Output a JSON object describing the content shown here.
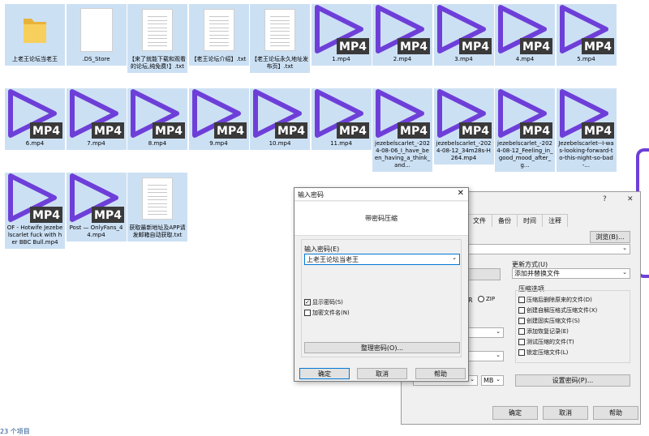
{
  "files": [
    {
      "name": "上老王论坛当老王",
      "kind": "folder"
    },
    {
      "name": ".DS_Store",
      "kind": "blank"
    },
    {
      "name": "【来了就能下载和观看的论坛,纯免费!】.txt",
      "kind": "doc"
    },
    {
      "name": "【老王论坛介绍】.txt",
      "kind": "doc"
    },
    {
      "name": "【老王论坛永久地址发布页】.txt",
      "kind": "doc"
    },
    {
      "name": "1.mp4",
      "kind": "mp4"
    },
    {
      "name": "2.mp4",
      "kind": "mp4"
    },
    {
      "name": "3.mp4",
      "kind": "mp4"
    },
    {
      "name": "4.mp4",
      "kind": "mp4"
    },
    {
      "name": "5.mp4",
      "kind": "mp4"
    },
    {
      "name": "6.mp4",
      "kind": "mp4"
    },
    {
      "name": "7.mp4",
      "kind": "mp4"
    },
    {
      "name": "8.mp4",
      "kind": "mp4"
    },
    {
      "name": "9.mp4",
      "kind": "mp4"
    },
    {
      "name": "10.mp4",
      "kind": "mp4"
    },
    {
      "name": "11.mp4",
      "kind": "mp4"
    },
    {
      "name": "jezebelscarlet_-2024-08-06_I_have_been_having_a_think_and...",
      "kind": "mp4"
    },
    {
      "name": "jezebelscarlet_-2024-08-12_34m28s-H264.mp4",
      "kind": "mp4"
    },
    {
      "name": "jezebelscarlet_-2024-08-12_Feeling_in_good_mood_after_g...",
      "kind": "mp4"
    },
    {
      "name": "Jezebelscarlet--I-was-looking-forward-to-this-night-so-bad-...",
      "kind": "mp4"
    },
    {
      "name": "OF - Hotwife Jezebelscarlet fuck with her BBC Bull.mp4",
      "kind": "mp4"
    },
    {
      "name": "Post — OnlyFans_44.mp4",
      "kind": "mp4"
    },
    {
      "name": "获取最新地址及APP请发邮箱自动获取.txt",
      "kind": "doc"
    }
  ],
  "mp4_badge": "MP4",
  "status_text": "23 个项目",
  "colors": {
    "mp4_purple": "#6e3fd8",
    "selection": "#cce0f4"
  },
  "archive_dialog": {
    "help_glyph": "?",
    "close_glyph": "✕",
    "tabs": [
      "文件",
      "备份",
      "时间",
      "注释"
    ],
    "browse_button": "浏览(B)...",
    "update_mode_label": "更新方式(U)",
    "update_mode_value": "添加并替换文件",
    "format_zip": "ZIP",
    "options_title": "压缩选项",
    "options": [
      {
        "label": "压缩后删除原来的文件(D)",
        "checked": false
      },
      {
        "label": "创建自解压格式压缩文件(X)",
        "checked": false
      },
      {
        "label": "创建固实压缩文件(S)",
        "checked": false
      },
      {
        "label": "添加恢复记录(E)",
        "checked": false
      },
      {
        "label": "测试压缩的文件(T)",
        "checked": false
      },
      {
        "label": "锁定压缩文件(L)",
        "checked": false
      }
    ],
    "size_unit": "MB",
    "set_password_button": "设置密码(P)...",
    "ok_button": "确定",
    "cancel_button": "取消",
    "help_button": "帮助"
  },
  "password_dialog": {
    "title": "输入密码",
    "heading": "带密码压缩",
    "enter_label": "输入密码(E)",
    "password_value": "上老王论坛当老王",
    "show_password": {
      "label": "显示密码(S)",
      "checked": true
    },
    "encrypt_names": {
      "label": "加密文件名(N)",
      "checked": false
    },
    "organize_button": "整理密码(O)...",
    "ok_button": "确定",
    "cancel_button": "取消",
    "help_button": "帮助",
    "close_glyph": "✕"
  }
}
